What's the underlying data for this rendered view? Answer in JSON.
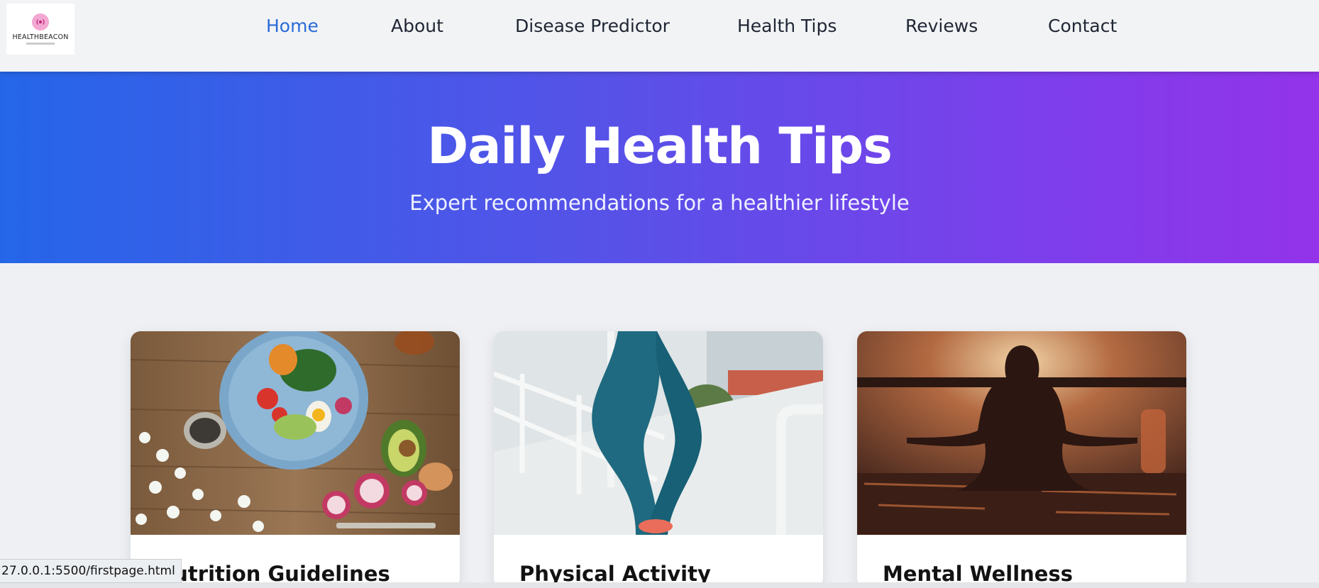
{
  "brand": {
    "logo_text": "HEALTHBEACON",
    "accent_pink": "#f3a8d2"
  },
  "nav": {
    "items": [
      {
        "label": "Home",
        "active": true
      },
      {
        "label": "About"
      },
      {
        "label": "Disease Predictor"
      },
      {
        "label": "Health Tips"
      },
      {
        "label": "Reviews"
      },
      {
        "label": "Contact"
      }
    ],
    "active_color": "#2a6bd8"
  },
  "hero": {
    "title": "Daily Health Tips",
    "subtitle": "Expert recommendations for a healthier lifestyle",
    "gradient_start": "#2566e8",
    "gradient_end": "#9333ea"
  },
  "cards": [
    {
      "title": "Nutrition Guidelines",
      "image": "healthy-food-bowl-photo"
    },
    {
      "title": "Physical Activity",
      "image": "legs-climbing-stairs-photo"
    },
    {
      "title": "Mental Wellness",
      "image": "meditation-sunset-photo"
    }
  ],
  "status_bar": {
    "url": "27.0.0.1:5500/firstpage.html"
  }
}
